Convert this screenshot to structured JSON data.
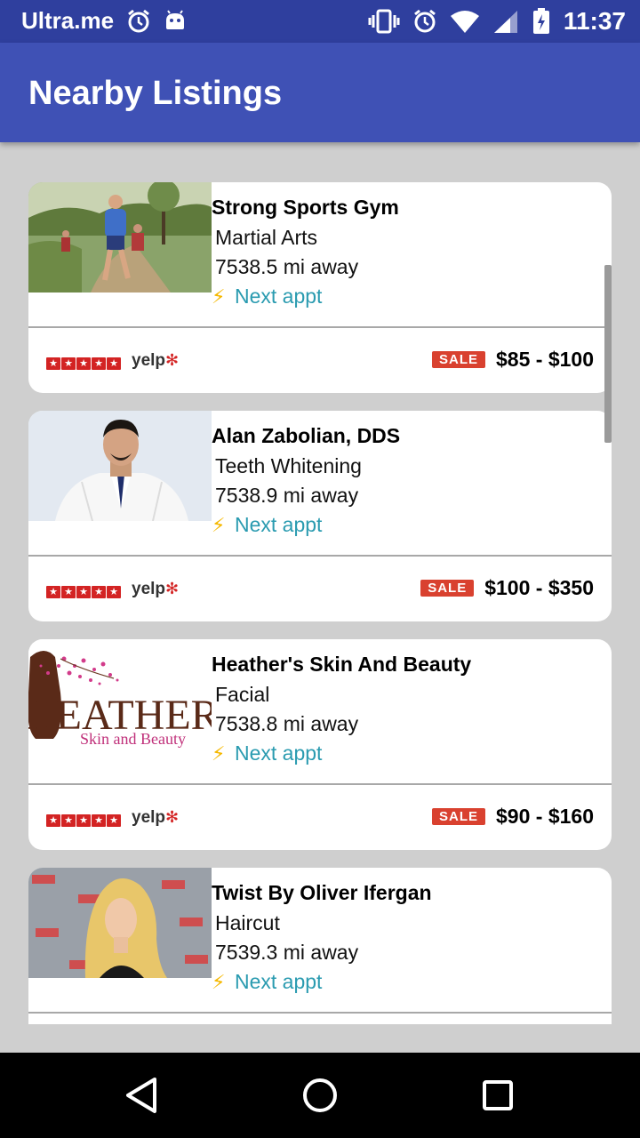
{
  "status_bar": {
    "carrier": "Ultra.me",
    "time": "11:37"
  },
  "app_bar": {
    "title": "Nearby Listings"
  },
  "listings": [
    {
      "name": "Strong Sports Gym",
      "category": "Martial Arts",
      "distance": "7538.5 mi away",
      "next_appt": "Next appt",
      "sale": "SALE",
      "price": "$85 - $100",
      "rating": 5
    },
    {
      "name": "Alan Zabolian, DDS",
      "category": "Teeth Whitening",
      "distance": "7538.9 mi away",
      "next_appt": "Next appt",
      "sale": "SALE",
      "price": "$100 - $350",
      "rating": 5
    },
    {
      "name": "Heather's Skin And Beauty",
      "category": "Facial",
      "distance": "7538.8 mi away",
      "next_appt": "Next appt",
      "sale": "SALE",
      "price": "$90 - $160",
      "rating": 5
    },
    {
      "name": "Twist By Oliver Ifergan",
      "category": "Haircut",
      "distance": "7539.3 mi away",
      "next_appt": "Next appt"
    }
  ],
  "yelp_label": "yelp",
  "heather_logo": {
    "big": "HEATHER",
    "small": "Skin and Beauty"
  },
  "colors": {
    "status_bar": "#2f3f9e",
    "app_bar": "#3f51b5",
    "next_appt": "#2a9bb0",
    "sale_badge": "#d9412f",
    "stars": "#d32323"
  },
  "icons": [
    "alarm-icon",
    "android-icon",
    "vibrate-icon",
    "wifi-icon",
    "signal-icon",
    "battery-icon",
    "back-icon",
    "home-icon",
    "recents-icon"
  ]
}
